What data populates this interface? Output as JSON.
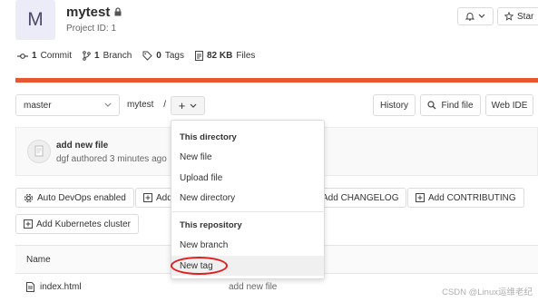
{
  "project": {
    "avatar_letter": "M",
    "name": "mytest",
    "id_label": "Project ID: 1"
  },
  "header_buttons": {
    "star_label": "Star"
  },
  "stats": {
    "commits": {
      "count": "1",
      "label": "Commit"
    },
    "branches": {
      "count": "1",
      "label": "Branch"
    },
    "tags": {
      "count": "0",
      "label": "Tags"
    },
    "files": {
      "count": "82 KB",
      "label": "Files"
    }
  },
  "toolbar": {
    "branch": "master",
    "breadcrumb": "mytest",
    "breadcrumb_sep": "/",
    "plus": "+",
    "history": "History",
    "find_file": "Find file",
    "web_ide": "Web IDE"
  },
  "commit": {
    "title": "add new file",
    "meta": "dgf authored 3 minutes ago"
  },
  "actions": {
    "auto_devops": "Auto DevOps enabled",
    "add_readme": "Add",
    "add_changelog": "Add CHANGELOG",
    "add_contributing": "Add CONTRIBUTING",
    "add_k8s": "Add Kubernetes cluster"
  },
  "table": {
    "header_name": "Name",
    "rows": [
      {
        "name": "index.html",
        "last_commit": "add new file"
      }
    ]
  },
  "dropdown": {
    "this_directory": "This directory",
    "new_file": "New file",
    "upload_file": "Upload file",
    "new_directory": "New directory",
    "this_repository": "This repository",
    "new_branch": "New branch",
    "new_tag": "New tag"
  },
  "watermark": "CSDN @Linux运维老纪",
  "colors": {
    "accent_orange": "#e8572f",
    "annotation_red": "#e02020"
  }
}
